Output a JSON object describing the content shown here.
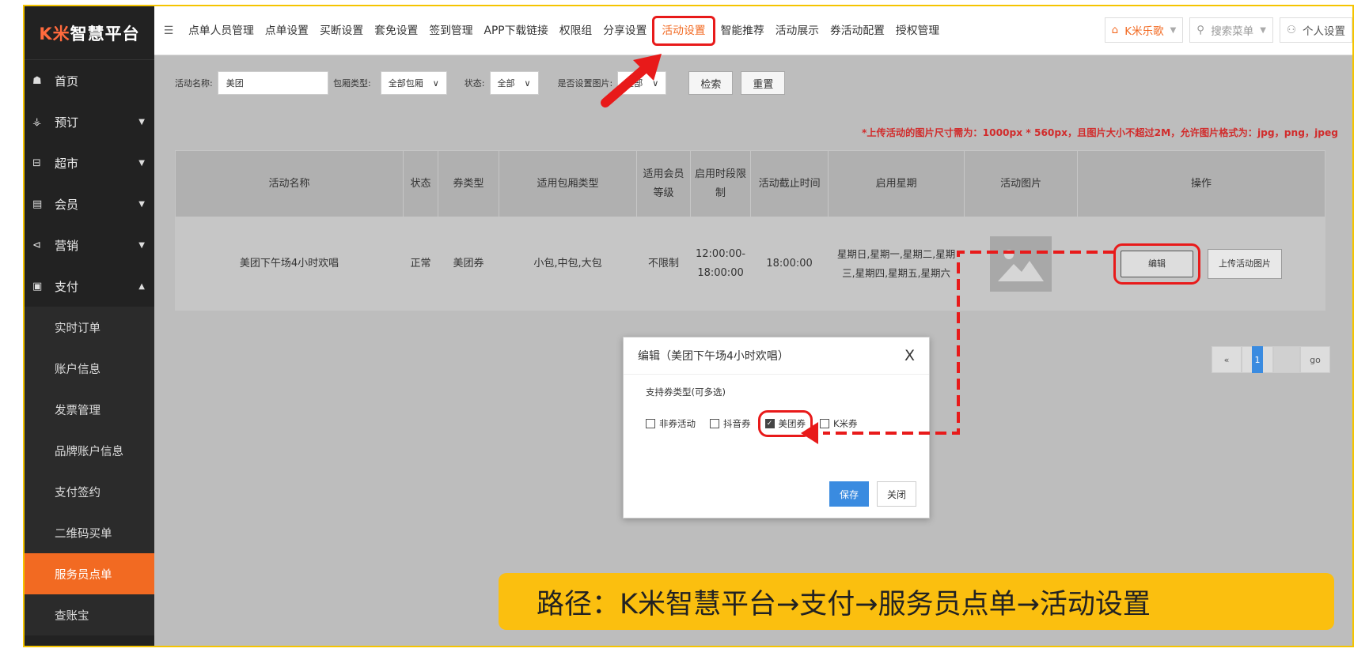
{
  "sidebar": {
    "logo_prefix": "K米",
    "logo_text": "智慧平台",
    "items": [
      {
        "icon": "home-icon",
        "glyph": "☗",
        "label": "首页",
        "caret": ""
      },
      {
        "icon": "reservation-icon",
        "glyph": "⚶",
        "label": "预订",
        "caret": "▼"
      },
      {
        "icon": "basket-icon",
        "glyph": "⊟",
        "label": "超市",
        "caret": "▼"
      },
      {
        "icon": "card-icon",
        "glyph": "▤",
        "label": "会员",
        "caret": "▼"
      },
      {
        "icon": "megaphone-icon",
        "glyph": "⊲",
        "label": "营销",
        "caret": "▼"
      },
      {
        "icon": "payment-icon",
        "glyph": "▣",
        "label": "支付",
        "caret": "▲"
      }
    ],
    "sub_items": [
      "实时订单",
      "账户信息",
      "发票管理",
      "品牌账户信息",
      "支付签约",
      "二维码买单",
      "服务员点单",
      "查账宝"
    ],
    "active_sub": "服务员点单"
  },
  "topbar": {
    "tabs": [
      "点单人员管理",
      "点单设置",
      "买断设置",
      "套免设置",
      "签到管理",
      "APP下载链接",
      "权限组",
      "分享设置",
      "活动设置",
      "智能推荐",
      "活动展示",
      "券活动配置",
      "授权管理"
    ],
    "active_tab": "活动设置",
    "brand": "K米乐歌",
    "search_placeholder": "搜索菜单",
    "personal": "个人设置"
  },
  "filters": {
    "name_label": "活动名称:",
    "name_value": "美团",
    "room_label": "包厢类型:",
    "room_value": "全部包厢",
    "status_label": "状态:",
    "status_value": "全部",
    "image_label": "是否设置图片:",
    "image_value": "全部",
    "search_btn": "检索",
    "reset_btn": "重置"
  },
  "notice": "*上传活动的图片尺寸需为：1000px * 560px，且图片大小不超过2M，允许图片格式为：jpg，png，jpeg",
  "table": {
    "headers": [
      "活动名称",
      "状态",
      "券类型",
      "适用包厢类型",
      "适用会员等级",
      "启用时段限制",
      "活动截止时间",
      "启用星期",
      "活动图片",
      "操作"
    ],
    "row": {
      "name": "美团下午场4小时欢唱",
      "status": "正常",
      "coupon": "美团券",
      "rooms": "小包,中包,大包",
      "member": "不限制",
      "period": "12:00:00-18:00:00",
      "deadline": "18:00:00",
      "weekdays": "星期日,星期一,星期二,星期三,星期四,星期五,星期六",
      "edit": "编辑",
      "upload": "上传活动图片"
    }
  },
  "pager": {
    "prev": "«",
    "current": "1",
    "go": "go"
  },
  "modal": {
    "title": "编辑（美团下午场4小时欢唱）",
    "close": "X",
    "section": "支持券类型(可多选)",
    "options": [
      {
        "label": "非券活动",
        "checked": false
      },
      {
        "label": "抖音券",
        "checked": false
      },
      {
        "label": "美团券",
        "checked": true
      },
      {
        "label": "K米券",
        "checked": false
      }
    ],
    "save": "保存",
    "cancel": "关闭"
  },
  "banner": "路径：K米智慧平台→支付→服务员点单→活动设置",
  "colors": {
    "accent": "#f26a22",
    "highlight": "#e81a1a",
    "banner": "#fbbf0f",
    "primary": "#3a8be0"
  }
}
